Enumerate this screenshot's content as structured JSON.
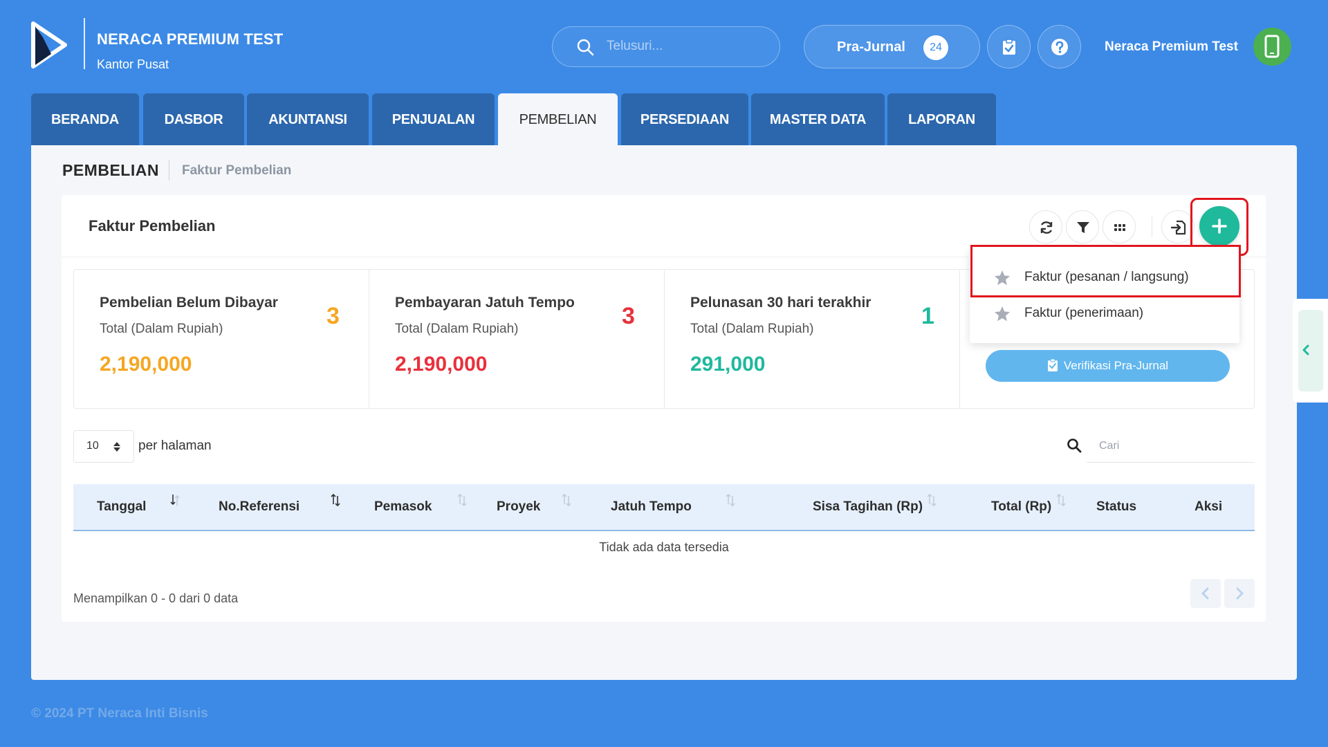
{
  "brand": {
    "title": "NERACA PREMIUM TEST",
    "subtitle": "Kantor Pusat"
  },
  "header": {
    "search_placeholder": "Telusuri...",
    "prajurnal_label": "Pra-Jurnal",
    "prajurnal_count": "24",
    "user_name": "Neraca Premium Test"
  },
  "tabs": [
    {
      "label": "BERANDA"
    },
    {
      "label": "DASBOR"
    },
    {
      "label": "AKUNTANSI"
    },
    {
      "label": "PENJUALAN"
    },
    {
      "label": "PEMBELIAN",
      "active": true
    },
    {
      "label": "PERSEDIAAN"
    },
    {
      "label": "MASTER DATA"
    },
    {
      "label": "LAPORAN"
    }
  ],
  "breadcrumb": {
    "main": "PEMBELIAN",
    "sub": "Faktur Pembelian"
  },
  "card": {
    "title": "Faktur Pembelian"
  },
  "stats": [
    {
      "title": "Pembelian Belum Dibayar",
      "sub": "Total (Dalam Rupiah)",
      "value": "2,190,000",
      "count": "3",
      "color": "#f5a623"
    },
    {
      "title": "Pembayaran Jatuh Tempo",
      "sub": "Total (Dalam Rupiah)",
      "value": "2,190,000",
      "count": "3",
      "color": "#e8313c"
    },
    {
      "title": "Pelunasan 30 hari terakhir",
      "sub": "Total (Dalam Rupiah)",
      "value": "291,000",
      "count": "1",
      "color": "#1fb99c"
    }
  ],
  "dropdown": {
    "items": [
      {
        "label": "Faktur (pesanan / langsung)"
      },
      {
        "label": "Faktur (penerimaan)"
      }
    ],
    "verify_label": "Verifikasi Pra-Jurnal"
  },
  "table": {
    "per_page_value": "10",
    "per_page_label": "per halaman",
    "search_placeholder": "Cari",
    "columns": [
      "Tanggal",
      "No.Referensi",
      "Pemasok",
      "Proyek",
      "Jatuh Tempo",
      "Sisa Tagihan (Rp)",
      "Total (Rp)",
      "Status",
      "Aksi"
    ],
    "empty_message": "Tidak ada data tersedia",
    "info": "Menampilkan 0 - 0 dari 0 data"
  },
  "footer": {
    "copyright": "© 2024 PT Neraca Inti Bisnis"
  },
  "colors": {
    "background": "#3c8ae6",
    "tab": "#2c67ad",
    "accent": "#1fb99c",
    "highlight": "#e0161e"
  }
}
